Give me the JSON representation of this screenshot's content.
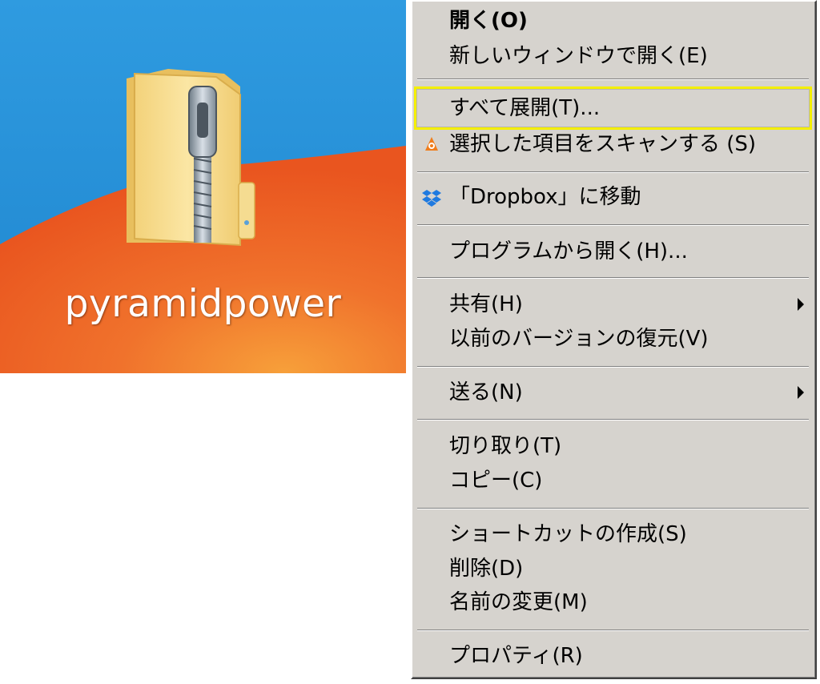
{
  "desktop": {
    "file_name": "pyramidpower",
    "icon": "zip-folder-icon"
  },
  "context_menu": {
    "items": [
      {
        "label": "開く(O)",
        "bold": true
      },
      {
        "label": "新しいウィンドウで開く(E)"
      },
      {
        "label": "すべて展開(T)...",
        "highlighted": true
      },
      {
        "label": "選択した項目をスキャンする (S)",
        "icon": "avast-scan-icon"
      },
      {
        "label": "「Dropbox」に移動",
        "icon": "dropbox-icon"
      },
      {
        "label": "プログラムから開く(H)..."
      },
      {
        "label": "共有(H)",
        "submenu": true
      },
      {
        "label": "以前のバージョンの復元(V)"
      },
      {
        "label": "送る(N)",
        "submenu": true
      },
      {
        "label": "切り取り(T)"
      },
      {
        "label": "コピー(C)"
      },
      {
        "label": "ショートカットの作成(S)"
      },
      {
        "label": "削除(D)"
      },
      {
        "label": "名前の変更(M)"
      },
      {
        "label": "プロパティ(R)"
      }
    ]
  },
  "colors": {
    "menu_background": "#d6d3ce",
    "highlight_outline": "#f4ef00",
    "desktop_blue": "#2a94dc",
    "desktop_orange": "#ef6a2a"
  }
}
